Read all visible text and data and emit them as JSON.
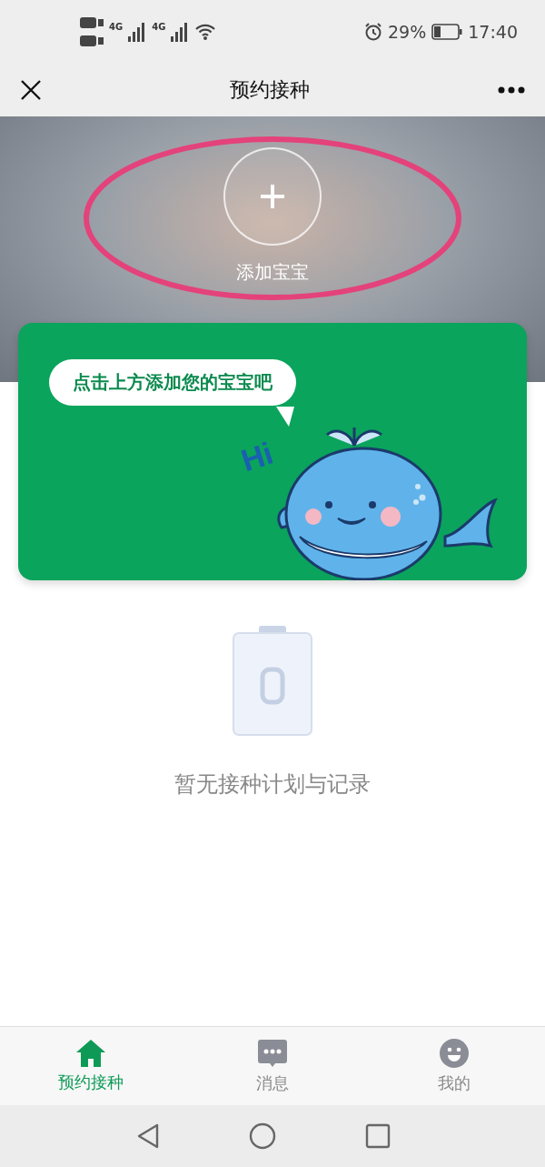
{
  "status_bar": {
    "network": [
      "4G",
      "4G"
    ],
    "battery": "29%",
    "time": "17:40"
  },
  "header": {
    "title": "预约接种"
  },
  "hero": {
    "add_label": "添加宝宝",
    "annotated": true
  },
  "banner": {
    "bubble": "点击上方添加您的宝宝吧",
    "greeting": "Hi"
  },
  "empty_state": {
    "message": "暂无接种计划与记录"
  },
  "tab_bar": [
    {
      "kind": "home",
      "label": "预约接种",
      "selected": true
    },
    {
      "kind": "chat",
      "label": "消息",
      "selected": false
    },
    {
      "kind": "face",
      "label": "我的",
      "selected": false
    }
  ]
}
